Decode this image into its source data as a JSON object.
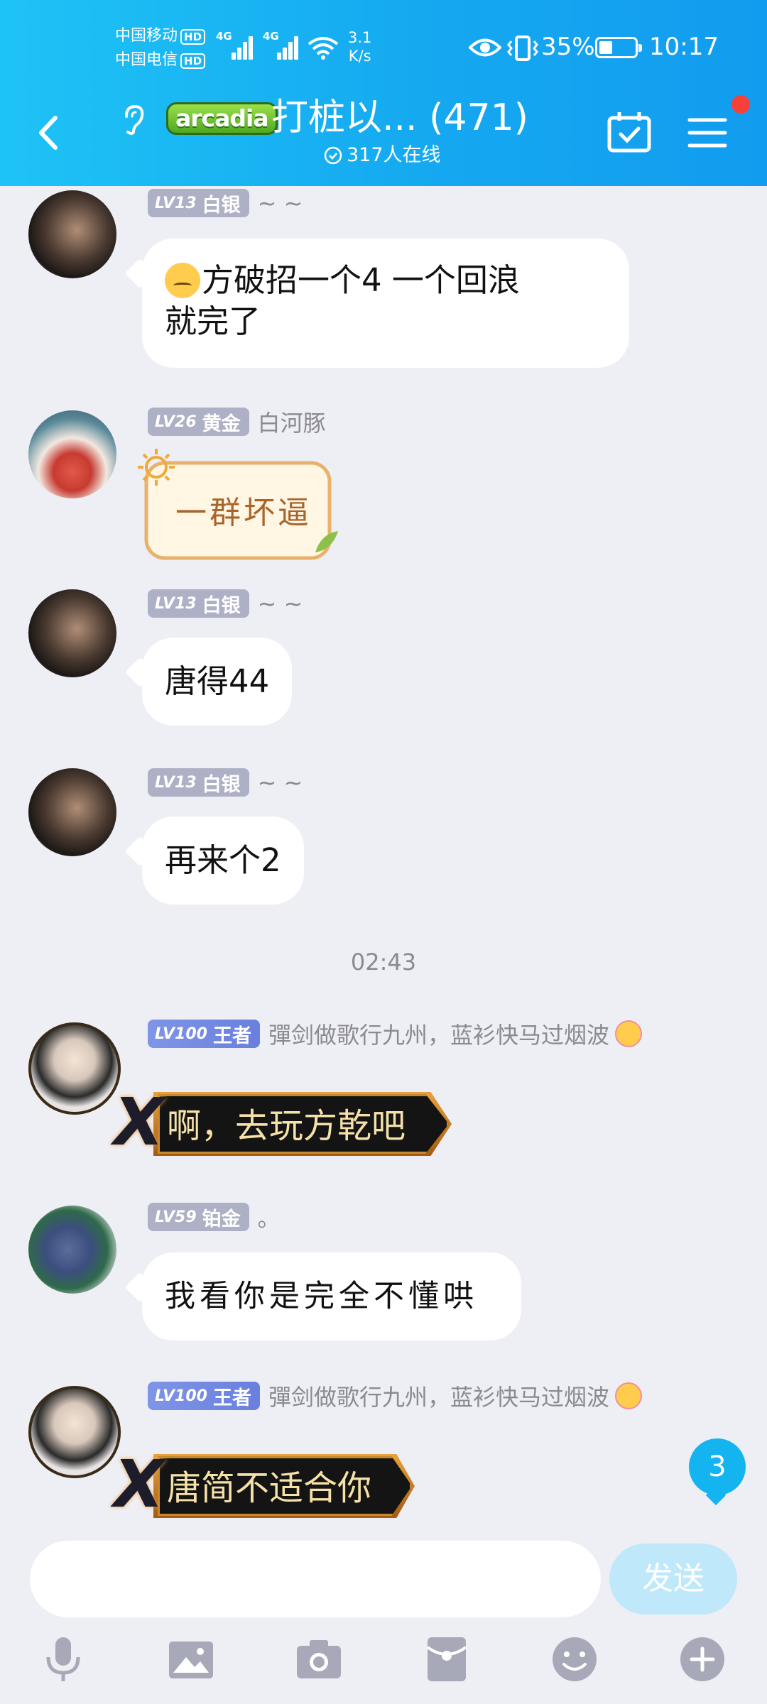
{
  "status_bar": {
    "carrier1": "中国移动",
    "carrier2": "中国电信",
    "hd": "HD",
    "network1": "4G",
    "network2": "4G",
    "speed_value": "3.1",
    "speed_unit": "K/s",
    "battery": "35%",
    "time": "10:17"
  },
  "header": {
    "logo_text": "arcadia",
    "title": "打桩以... (471)",
    "online": "317人在线"
  },
  "messages": [
    {
      "level": "LV13",
      "rank": "白银",
      "nick": "~ ~",
      "text_line1": "方破招一个4 一个回浪",
      "text_line2": "就完了"
    },
    {
      "level": "LV26",
      "rank": "黄金",
      "nick": "白河豚",
      "sticker_text": "一群坏逼"
    },
    {
      "level": "LV13",
      "rank": "白银",
      "nick": "~ ~",
      "text": "唐得44"
    },
    {
      "level": "LV13",
      "rank": "白银",
      "nick": "~ ~",
      "text": "再来个2"
    },
    {
      "level": "LV100",
      "rank": "王者",
      "nick": "彈剑做歌行九州，蓝衫快马过烟波",
      "text": "啊，去玩方乾吧"
    },
    {
      "level": "LV59",
      "rank": "铂金",
      "nick": "。",
      "text": "我看你是完全不懂哄"
    },
    {
      "level": "LV100",
      "rank": "王者",
      "nick": "彈剑做歌行九州，蓝衫快马过烟波",
      "text": "唐简不适合你"
    }
  ],
  "time_separator": "02:43",
  "unread_count": "3",
  "input": {
    "placeholder": "",
    "send_label": "发送"
  },
  "colors": {
    "header_start": "#1ec3f6",
    "header_end": "#129cef",
    "bg": "#eeeef5",
    "send_disabled": "#bfe8fb"
  }
}
